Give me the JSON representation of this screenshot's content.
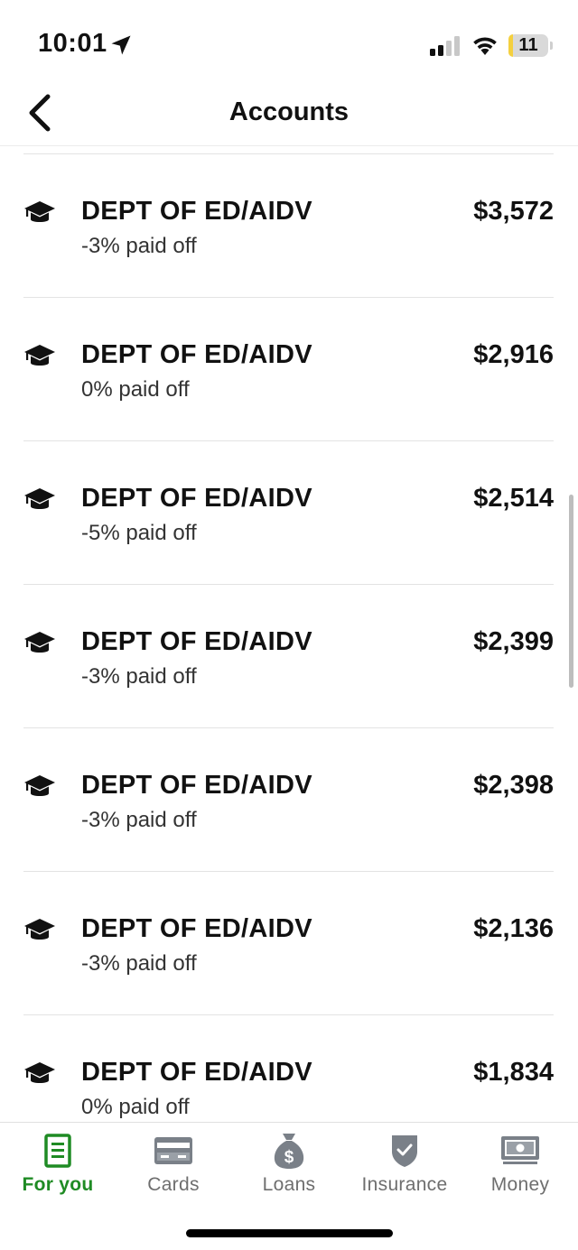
{
  "status_bar": {
    "time": "10:01",
    "battery_level": "11",
    "battery_fraction": 0.11
  },
  "header": {
    "title": "Accounts",
    "back_icon": "chevron-left-icon"
  },
  "accounts": [
    {
      "name": "DEPT OF ED/AIDV",
      "subtitle": "-3% paid off",
      "amount": "$3,572",
      "icon": "graduation-cap-icon"
    },
    {
      "name": "DEPT OF ED/AIDV",
      "subtitle": "0% paid off",
      "amount": "$2,916",
      "icon": "graduation-cap-icon"
    },
    {
      "name": "DEPT OF ED/AIDV",
      "subtitle": "-5% paid off",
      "amount": "$2,514",
      "icon": "graduation-cap-icon"
    },
    {
      "name": "DEPT OF ED/AIDV",
      "subtitle": "-3% paid off",
      "amount": "$2,399",
      "icon": "graduation-cap-icon"
    },
    {
      "name": "DEPT OF ED/AIDV",
      "subtitle": "-3% paid off",
      "amount": "$2,398",
      "icon": "graduation-cap-icon"
    },
    {
      "name": "DEPT OF ED/AIDV",
      "subtitle": "-3% paid off",
      "amount": "$2,136",
      "icon": "graduation-cap-icon"
    },
    {
      "name": "DEPT OF ED/AIDV",
      "subtitle": "0% paid off",
      "amount": "$1,834",
      "icon": "graduation-cap-icon"
    }
  ],
  "tabs": [
    {
      "label": "For you",
      "icon": "document-list-icon",
      "active": true
    },
    {
      "label": "Cards",
      "icon": "credit-card-icon",
      "active": false
    },
    {
      "label": "Loans",
      "icon": "money-bag-icon",
      "active": false
    },
    {
      "label": "Insurance",
      "icon": "shield-check-icon",
      "active": false
    },
    {
      "label": "Money",
      "icon": "cash-bill-icon",
      "active": false
    }
  ],
  "colors": {
    "accent": "#1f8b24",
    "inactive_icon": "#7a8088",
    "text": "#111111",
    "divider": "#e3e3e3",
    "battery": "#f4d03f"
  }
}
